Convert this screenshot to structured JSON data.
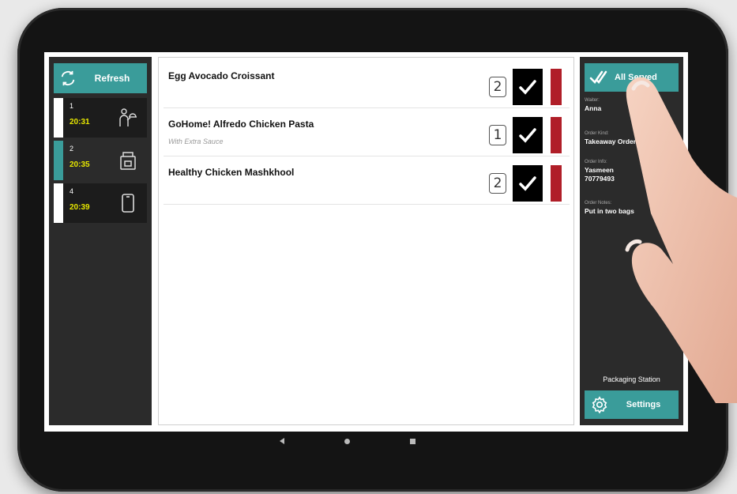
{
  "left": {
    "refresh_label": "Refresh",
    "orders": [
      {
        "number": "1",
        "time": "20:31",
        "icon": "waiter-serving-icon"
      },
      {
        "number": "2",
        "time": "20:35",
        "icon": "takeaway-bag-icon"
      },
      {
        "number": "4",
        "time": "20:39",
        "icon": "phone-icon"
      }
    ]
  },
  "items": [
    {
      "name": "Egg Avocado Croissant",
      "note": "",
      "qty": "2"
    },
    {
      "name": "GoHome! Alfredo Chicken Pasta",
      "note": "With Extra Sauce",
      "qty": "1"
    },
    {
      "name": "Healthy Chicken Mashkhool",
      "note": "",
      "qty": "2"
    }
  ],
  "right": {
    "all_served_label": "All Served",
    "waiter_label": "Waiter:",
    "waiter": "Anna",
    "order_kind_label": "Order Kind:",
    "order_kind": "Takeaway Order",
    "order_info_label": "Order Info:",
    "order_info_name": "Yasmeen",
    "order_info_phone": "70779493",
    "order_notes_label": "Order Notes:",
    "order_notes": "Put in two bags",
    "station": "Packaging Station",
    "settings_label": "Settings"
  },
  "colors": {
    "accent": "#3a9c9a",
    "panel": "#2b2b2b",
    "time": "#e6e600",
    "status_bar": "#b01e28"
  }
}
